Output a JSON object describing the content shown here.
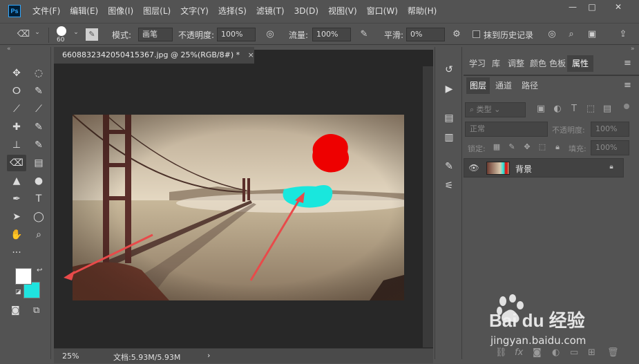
{
  "app": {
    "logo": "Ps"
  },
  "menubar": {
    "items": [
      "文件(F)",
      "编辑(E)",
      "图像(I)",
      "图层(L)",
      "文字(Y)",
      "选择(S)",
      "滤镜(T)",
      "3D(D)",
      "视图(V)",
      "窗口(W)",
      "帮助(H)"
    ]
  },
  "window_controls": {
    "minimize": "—",
    "maximize": "□",
    "close": "✕"
  },
  "options": {
    "brush_size": "60",
    "mode_label": "模式:",
    "mode_value": "画笔",
    "opacity_label": "不透明度:",
    "opacity_value": "100%",
    "flow_label": "流量:",
    "flow_value": "100%",
    "smooth_label": "平滑:",
    "smooth_value": "0%",
    "history_label": "抹到历史记录"
  },
  "document": {
    "tab_title": "6608832342050415367.jpg @ 25%(RGB/8#) *",
    "close": "×"
  },
  "status": {
    "zoom": "25%",
    "doc_info": "文档:5.93M/5.93M",
    "arrow": "›"
  },
  "tools": [
    {
      "name": "move-tool",
      "glyph": "✥"
    },
    {
      "name": "marquee-tool",
      "glyph": "◌"
    },
    {
      "name": "lasso-tool",
      "glyph": "ⵔ"
    },
    {
      "name": "quick-select-tool",
      "glyph": "✎"
    },
    {
      "name": "crop-tool",
      "glyph": "⟋"
    },
    {
      "name": "eyedropper-tool",
      "glyph": "⟋"
    },
    {
      "name": "healing-tool",
      "glyph": "✚"
    },
    {
      "name": "brush-tool",
      "glyph": "✎"
    },
    {
      "name": "stamp-tool",
      "glyph": "⊥"
    },
    {
      "name": "history-brush-tool",
      "glyph": "✎"
    },
    {
      "name": "eraser-tool",
      "glyph": "⌫"
    },
    {
      "name": "gradient-tool",
      "glyph": "▤"
    },
    {
      "name": "blur-tool",
      "glyph": "▲"
    },
    {
      "name": "dodge-tool",
      "glyph": "●"
    },
    {
      "name": "pen-tool",
      "glyph": "✒"
    },
    {
      "name": "type-tool",
      "glyph": "T"
    },
    {
      "name": "path-select-tool",
      "glyph": "➤"
    },
    {
      "name": "ellipse-tool",
      "glyph": "◯"
    },
    {
      "name": "hand-tool",
      "glyph": "✋"
    },
    {
      "name": "zoom-tool",
      "glyph": "⌕"
    },
    {
      "name": "more-tools",
      "glyph": "···"
    }
  ],
  "colors": {
    "foreground": "#ffffff",
    "background": "#1fe3df",
    "accent_red": "#ee0000",
    "accent_cyan": "#19e7dd"
  },
  "panel_tabs_top": [
    "学习",
    "库",
    "调整",
    "颜色",
    "色板",
    "属性"
  ],
  "panel_tabs_layers": [
    "图层",
    "通道",
    "路径"
  ],
  "layers_panel": {
    "search_kind": "类型",
    "blend_mode": "正常",
    "opacity_label": "不透明度:",
    "opacity_value": "100%",
    "lock_label": "锁定:",
    "fill_label": "填充:",
    "fill_value": "100%",
    "layer_name": "背景"
  },
  "watermark": {
    "brand": "Bai du 经验",
    "url": "jingyan.baidu.com"
  }
}
